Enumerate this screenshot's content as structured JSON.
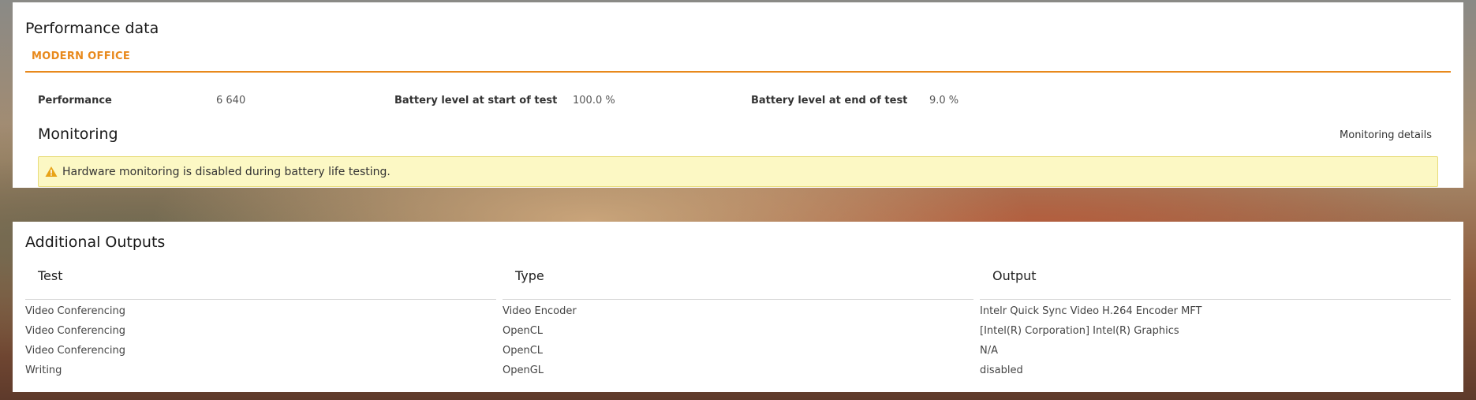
{
  "performance": {
    "title": "Performance data",
    "tab": "MODERN OFFICE",
    "metrics": [
      {
        "label": "Performance",
        "value": "6 640"
      },
      {
        "label": "Battery level at start of test",
        "value": "100.0 %"
      },
      {
        "label": "Battery level at end of test",
        "value": "9.0 %"
      }
    ]
  },
  "monitoring": {
    "title": "Monitoring",
    "details_link": "Monitoring details",
    "alert_text": "Hardware monitoring is disabled during battery life testing.",
    "alert_icon": "warning-icon",
    "alert_color": "#e8a317"
  },
  "outputs": {
    "title": "Additional Outputs",
    "columns": [
      "Test",
      "Type",
      "Output"
    ],
    "rows": [
      [
        "Video Conferencing",
        "Video Encoder",
        "Intelr Quick Sync Video H.264 Encoder MFT"
      ],
      [
        "Video Conferencing",
        "OpenCL",
        "[Intel(R) Corporation] Intel(R) Graphics"
      ],
      [
        "Video Conferencing",
        "OpenCL",
        "N/A"
      ],
      [
        "Writing",
        "OpenGL",
        "disabled"
      ]
    ]
  },
  "accent_color": "#e8891c"
}
